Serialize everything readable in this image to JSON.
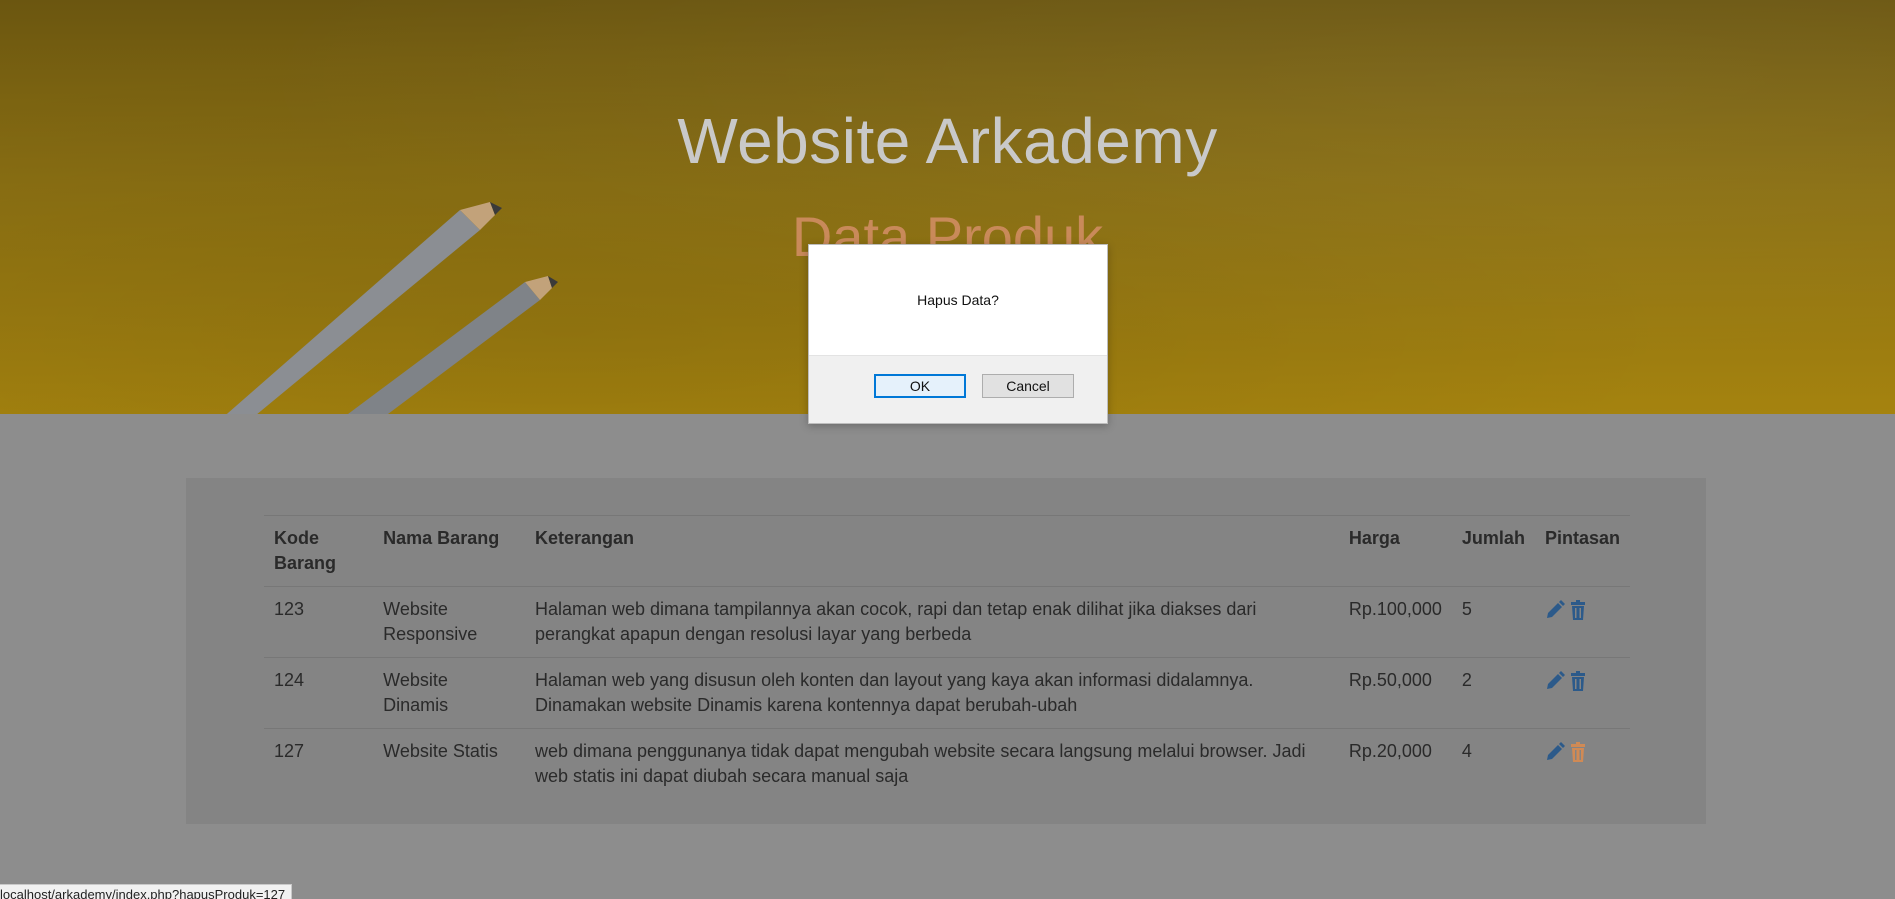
{
  "hero": {
    "title": "Website Arkademy",
    "subtitle": "Data Produk"
  },
  "table": {
    "headers": {
      "kode": "Kode Barang",
      "nama": "Nama Barang",
      "keterangan": "Keterangan",
      "harga": "Harga",
      "jumlah": "Jumlah",
      "pintasan": "Pintasan"
    },
    "rows": [
      {
        "kode": "123",
        "nama": "Website Responsive",
        "keterangan": "Halaman web dimana tampilannya akan cocok, rapi dan tetap enak dilihat jika diakses dari perangkat apapun dengan resolusi layar yang berbeda",
        "harga": "Rp.100,000",
        "jumlah": "5"
      },
      {
        "kode": "124",
        "nama": "Website Dinamis",
        "keterangan": "Halaman web yang disusun oleh konten dan layout yang kaya akan informasi didalamnya. Dinamakan website Dinamis karena kontennya dapat berubah-ubah",
        "harga": "Rp.50,000",
        "jumlah": "2"
      },
      {
        "kode": "127",
        "nama": "Website Statis",
        "keterangan": "web dimana penggunanya tidak dapat mengubah website secara langsung melalui browser. Jadi web statis ini dapat diubah secara manual saja",
        "harga": "Rp.20,000",
        "jumlah": "4"
      }
    ]
  },
  "icons": {
    "edit": "pencil-icon",
    "delete": "trash-icon"
  },
  "colors": {
    "edit_icon": "#2c5a8a",
    "delete_icon": "#2c5a8a",
    "delete_icon_hover": "#d08a55",
    "ok_border": "#0078d7"
  },
  "dialog": {
    "message": "Hapus Data?",
    "ok_label": "OK",
    "cancel_label": "Cancel"
  },
  "statusbar": {
    "url": "localhost/arkademy/index.php?hapusProduk=127"
  }
}
